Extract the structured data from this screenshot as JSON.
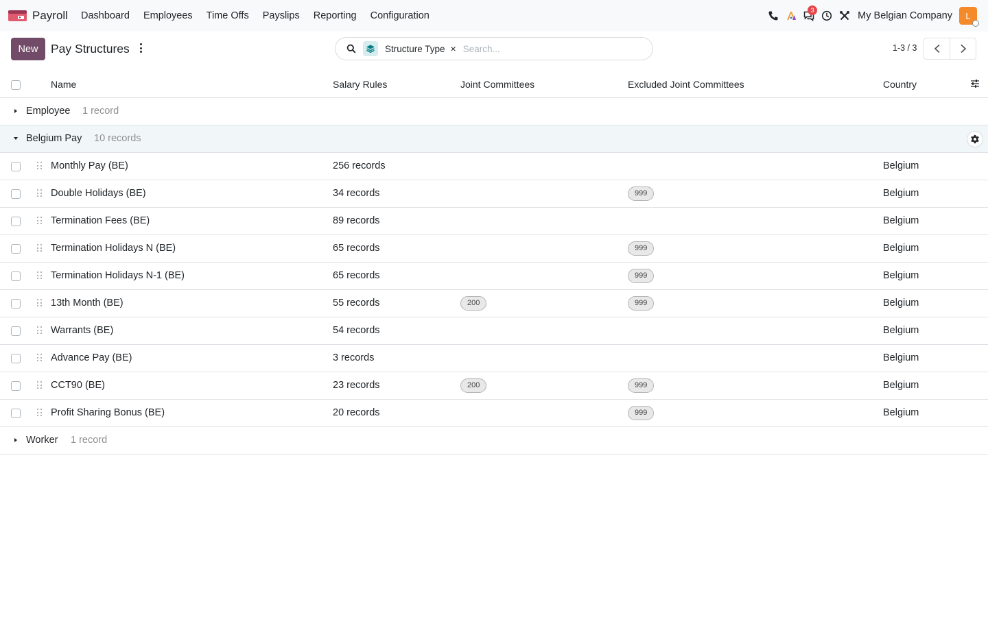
{
  "navbar": {
    "app_name": "Payroll",
    "menu": [
      "Dashboard",
      "Employees",
      "Time Offs",
      "Payslips",
      "Reporting",
      "Configuration"
    ],
    "messages_badge": "3",
    "company": "My Belgian Company",
    "avatar_initial": "L",
    "avatar_color": "#f58a2b"
  },
  "control_panel": {
    "new_label": "New",
    "title": "Pay Structures",
    "search": {
      "facet_label": "Structure Type",
      "facet_remove": "×",
      "placeholder": "Search..."
    },
    "pager": "1-3 / 3"
  },
  "columns": {
    "name": "Name",
    "salary_rules": "Salary Rules",
    "joint_committees": "Joint Committees",
    "excluded_joint_committees": "Excluded Joint Committees",
    "country": "Country"
  },
  "groups": [
    {
      "name": "Employee",
      "count": "1 record",
      "open": false
    },
    {
      "name": "Belgium Pay",
      "count": "10 records",
      "open": true
    },
    {
      "name": "Worker",
      "count": "1 record",
      "open": false
    }
  ],
  "rows": [
    {
      "name": "Monthly Pay (BE)",
      "rules": "256 records",
      "joint": "",
      "excluded": "",
      "country": "Belgium"
    },
    {
      "name": "Double Holidays (BE)",
      "rules": "34 records",
      "joint": "",
      "excluded": "999",
      "country": "Belgium"
    },
    {
      "name": "Termination Fees (BE)",
      "rules": "89 records",
      "joint": "",
      "excluded": "",
      "country": "Belgium"
    },
    {
      "name": "Termination Holidays N (BE)",
      "rules": "65 records",
      "joint": "",
      "excluded": "999",
      "country": "Belgium"
    },
    {
      "name": "Termination Holidays N-1 (BE)",
      "rules": "65 records",
      "joint": "",
      "excluded": "999",
      "country": "Belgium"
    },
    {
      "name": "13th Month (BE)",
      "rules": "55 records",
      "joint": "200",
      "excluded": "999",
      "country": "Belgium"
    },
    {
      "name": "Warrants (BE)",
      "rules": "54 records",
      "joint": "",
      "excluded": "",
      "country": "Belgium"
    },
    {
      "name": "Advance Pay (BE)",
      "rules": "3 records",
      "joint": "",
      "excluded": "",
      "country": "Belgium"
    },
    {
      "name": "CCT90 (BE)",
      "rules": "23 records",
      "joint": "200",
      "excluded": "999",
      "country": "Belgium"
    },
    {
      "name": "Profit Sharing Bonus (BE)",
      "rules": "20 records",
      "joint": "",
      "excluded": "999",
      "country": "Belgium"
    }
  ],
  "icons": {
    "app": "payroll-app-icon",
    "phone": "phone-icon",
    "ai": "ai-icon",
    "messages": "messages-icon",
    "activity": "clock-icon",
    "debug": "tools-icon",
    "search": "search-icon",
    "facet": "layers-icon",
    "optional_columns": "sliders-icon",
    "group_config": "gear-icon"
  },
  "colors": {
    "primary": "#714b67",
    "group_open_bg": "#f1f7f8",
    "badge": "#e4484b"
  }
}
